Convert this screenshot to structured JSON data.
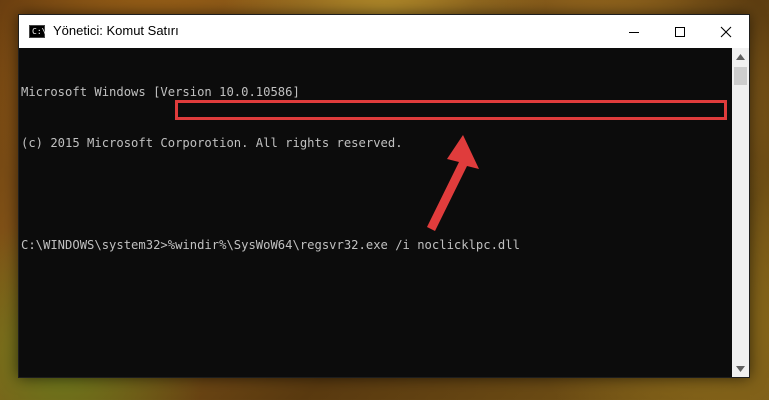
{
  "window": {
    "title": "Yönetici: Komut Satırı",
    "icon_label": "C:\\",
    "controls": {
      "minimize_icon": "minimize-icon",
      "maximize_icon": "maximize-icon",
      "close_icon": "close-icon"
    }
  },
  "console": {
    "lines": [
      "Microsoft Windows [Version 10.0.10586]",
      "(c) 2015 Microsoft Corporotion. All rights reserved.",
      ""
    ],
    "prompt": "C:\\WINDOWS\\system32>",
    "command": "%windir%\\SysWoW64\\regsvr32.exe /i noclicklpc.dll"
  },
  "annotation": {
    "highlight_color": "#e03c3c",
    "arrow_color": "#e03c3c"
  }
}
